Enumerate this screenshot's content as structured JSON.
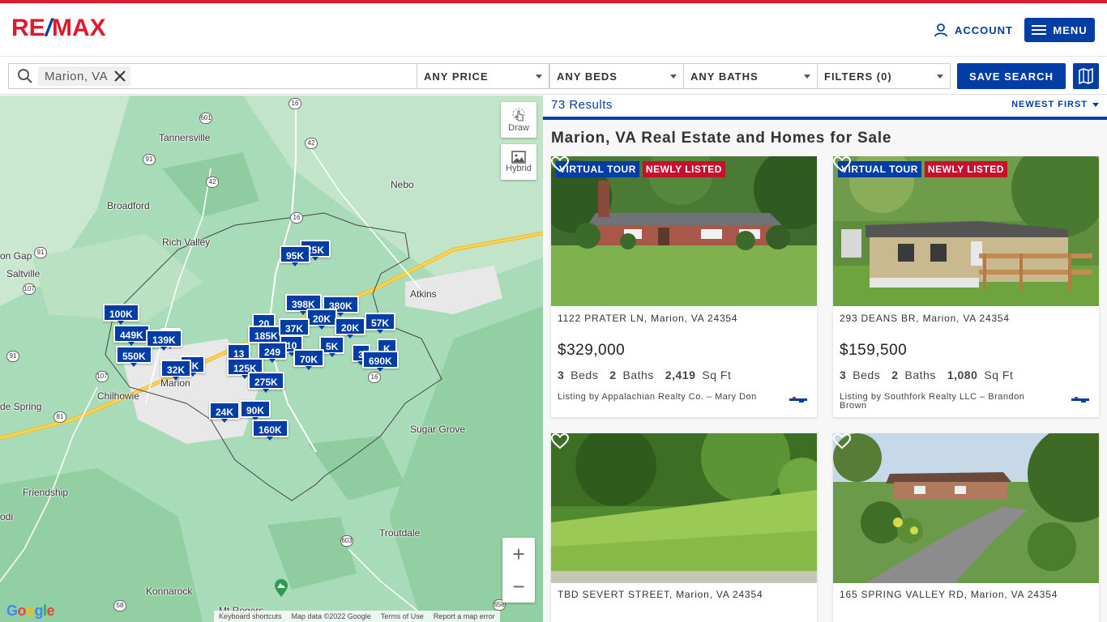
{
  "header": {
    "logo": {
      "re": "RE",
      "slash": "/",
      "max": "MAX"
    },
    "account_label": "ACCOUNT",
    "menu_label": "MENU"
  },
  "search": {
    "chip_text": "Marion, VA",
    "filters": [
      {
        "label": "ANY PRICE"
      },
      {
        "label": "ANY BEDS"
      },
      {
        "label": "ANY BATHS"
      },
      {
        "label": "FILTERS (0)"
      }
    ],
    "save_label": "SAVE SEARCH"
  },
  "map": {
    "tools": {
      "draw_label": "Draw",
      "hybrid_label": "Hybrid"
    },
    "places": [
      "Tannersville",
      "Broadford",
      "Nebo",
      "Rich Valley",
      "on Gap",
      "Saltville",
      "Atkins",
      "Chilhowie",
      "Marion",
      "de Spring",
      "Sugar Grove",
      "Friendship",
      "odi",
      "Troutdale",
      "Konnarock",
      "Mt Rogers"
    ],
    "routes": [
      "601",
      "16",
      "91",
      "42",
      "42",
      "16",
      "91",
      "107",
      "91",
      "107",
      "81",
      "16",
      "603",
      "58",
      "658",
      "16"
    ],
    "pins": [
      "95K",
      "25K",
      "100K",
      "398K",
      "380K",
      "449K",
      "139K",
      "K",
      "20",
      "185K",
      "37K",
      "20K",
      "57K",
      "550K",
      "13",
      "249",
      "10",
      "5K",
      "3",
      "K",
      "0K",
      "32K",
      "125K",
      "70K",
      "690K",
      "275K",
      "24K",
      "90K",
      "160K"
    ],
    "google_label": "Google",
    "attribution": [
      "Keyboard shortcuts",
      "Map data ©2022 Google",
      "Terms of Use",
      "Report a map error"
    ]
  },
  "results": {
    "count_text": "73 Results",
    "sort_label": "NEWEST FIRST",
    "page_title": "Marion, VA Real Estate and Homes for Sale",
    "listings": [
      {
        "badges": [
          "VIRTUAL TOUR",
          "NEWLY LISTED"
        ],
        "address": "1122 PRATER LN, Marion, VA 24354",
        "price": "$329,000",
        "beds": "3",
        "beds_label": "Beds",
        "baths": "2",
        "baths_label": "Baths",
        "sqft": "2,419",
        "sqft_label": "Sq Ft",
        "listing_by": "Listing by Appalachian Realty Co. – Mary Don"
      },
      {
        "badges": [
          "VIRTUAL TOUR",
          "NEWLY LISTED"
        ],
        "address": "293 DEANS BR, Marion, VA 24354",
        "price": "$159,500",
        "beds": "3",
        "beds_label": "Beds",
        "baths": "2",
        "baths_label": "Baths",
        "sqft": "1,080",
        "sqft_label": "Sq Ft",
        "listing_by": "Listing by Southfork Realty LLC – Brandon Brown"
      },
      {
        "badges": [],
        "address": "TBD SEVERT STREET, Marion, VA 24354"
      },
      {
        "badges": [],
        "address": "165 SPRING VALLEY RD, Marion, VA 24354"
      }
    ]
  },
  "colors": {
    "brand_blue": "#003da5",
    "brand_red": "#dc1c2e",
    "map_green": "#a8dbb8"
  }
}
